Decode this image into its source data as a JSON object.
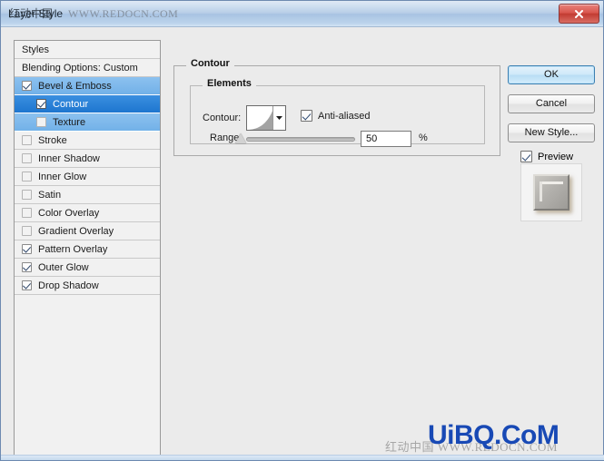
{
  "window": {
    "title": "Layer Style",
    "watermark_cn": "红动中国",
    "watermark_url": "WWW.REDOCN.COM",
    "close_icon": "close-icon"
  },
  "styles_panel": {
    "header": "Styles",
    "blending_options": "Blending Options: Custom",
    "items": [
      {
        "label": "Bevel & Emboss",
        "checked": true,
        "selected": "light",
        "indent": false
      },
      {
        "label": "Contour",
        "checked": true,
        "selected": "strong",
        "indent": true
      },
      {
        "label": "Texture",
        "checked": false,
        "selected": "none",
        "indent": true
      },
      {
        "label": "Stroke",
        "checked": false,
        "selected": "none",
        "indent": false
      },
      {
        "label": "Inner Shadow",
        "checked": false,
        "selected": "none",
        "indent": false
      },
      {
        "label": "Inner Glow",
        "checked": false,
        "selected": "none",
        "indent": false
      },
      {
        "label": "Satin",
        "checked": false,
        "selected": "none",
        "indent": false
      },
      {
        "label": "Color Overlay",
        "checked": false,
        "selected": "none",
        "indent": false
      },
      {
        "label": "Gradient Overlay",
        "checked": false,
        "selected": "none",
        "indent": false
      },
      {
        "label": "Pattern Overlay",
        "checked": true,
        "selected": "none",
        "indent": false
      },
      {
        "label": "Outer Glow",
        "checked": true,
        "selected": "none",
        "indent": false
      },
      {
        "label": "Drop Shadow",
        "checked": true,
        "selected": "none",
        "indent": false
      }
    ]
  },
  "contour_panel": {
    "group_title": "Contour",
    "elements_title": "Elements",
    "contour_label": "Contour:",
    "contour_dropdown_icon": "chevron-down-icon",
    "antialiased_label": "Anti-aliased",
    "antialiased_checked": true,
    "range_label": "Range:",
    "range_value": "50",
    "range_unit": "%",
    "range_percent": 50
  },
  "buttons": {
    "ok": "OK",
    "cancel": "Cancel",
    "new_style": "New Style...",
    "preview_label": "Preview",
    "preview_checked": true
  },
  "page_watermarks": {
    "big": "UiBQ.CoM",
    "faint": "红动中国 WWW.REDOCN.COM"
  },
  "colors": {
    "dialog_bg": "#ebebeb",
    "titlebar_blue": "#a8c3e2",
    "selection_strong": "#1e76cf",
    "selection_light": "#72b1e8",
    "close_red": "#c23b32",
    "watermark_blue": "#1849b5"
  }
}
